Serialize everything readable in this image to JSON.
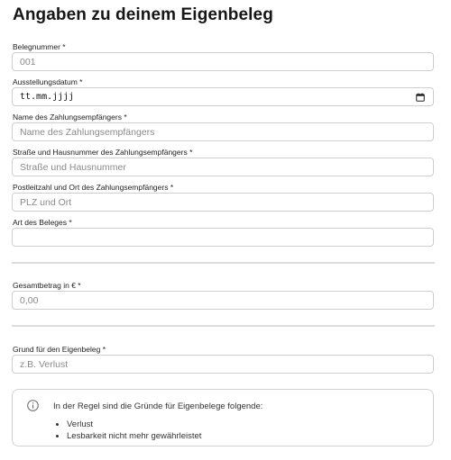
{
  "page_title": "Angaben zu deinem Eigenbeleg",
  "fields": {
    "belegnummer": {
      "label": "Belegnummer *",
      "value": "001"
    },
    "ausstellungsdatum": {
      "label": "Ausstellungsdatum *",
      "value": "tt.mm.jjjj",
      "icon": "calendar-icon"
    },
    "empfaenger_name": {
      "label": "Name des Zahlungsempfängers *",
      "placeholder": "Name des Zahlungsempfängers"
    },
    "empfaenger_strasse": {
      "label": "Straße und Hausnummer des Zahlungsempfängers *",
      "placeholder": "Straße und Hausnummer"
    },
    "empfaenger_plz_ort": {
      "label": "Postleitzahl und Ort des Zahlungsempfängers *",
      "placeholder": "PLZ und Ort"
    },
    "art_des_beleges": {
      "label": "Art des Beleges *",
      "placeholder": ""
    },
    "gesamtbetrag": {
      "label": "Gesamtbetrag in € *",
      "placeholder": "0,00"
    },
    "grund": {
      "label": "Grund für den Eigenbeleg *",
      "placeholder": "z.B. Verlust"
    }
  },
  "info": {
    "icon": "info-icon",
    "text": "In der Regel sind die Gründe für Eigenbelege folgende:",
    "items": [
      "Verlust",
      "Lesbarkeit nicht mehr gewährleistet"
    ]
  },
  "colors": {
    "border": "#cfcfcf",
    "divider": "#dcdcdc",
    "placeholder": "#8a8a8a"
  }
}
